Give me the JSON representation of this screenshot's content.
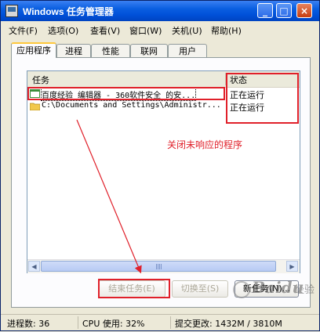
{
  "window": {
    "title": "Windows 任务管理器"
  },
  "title_buttons": {
    "minimize": "_",
    "maximize": "□",
    "close": "×"
  },
  "menu": [
    "文件(F)",
    "选项(O)",
    "查看(V)",
    "窗口(W)",
    "关机(U)",
    "帮助(H)"
  ],
  "tabs": [
    "应用程序",
    "进程",
    "性能",
    "联网",
    "用户"
  ],
  "list": {
    "columns": {
      "task": "任务",
      "status": "状态"
    },
    "rows": [
      {
        "task": "百度经验 编辑器 - 360软件安全 的安...",
        "status": "正在运行",
        "icon": "browser-icon"
      },
      {
        "task": "C:\\Documents and Settings\\Administr...",
        "status": "正在运行",
        "icon": "folder-icon"
      }
    ]
  },
  "buttons": {
    "end_task": "结束任务(E)",
    "switch_to": "切换至(S)",
    "new_task": "新任务(N)..."
  },
  "statusbar": {
    "processes": "进程数: 36",
    "cpu": "CPU 使用: 32%",
    "commit": "提交更改: 1432M / 3810M"
  },
  "annotation": "关闭未响应的程序",
  "watermark": {
    "brand": "Baidu",
    "sub": "经验"
  },
  "colors": {
    "highlight": "#e0202a",
    "titlebar": "#0a5ee0"
  }
}
